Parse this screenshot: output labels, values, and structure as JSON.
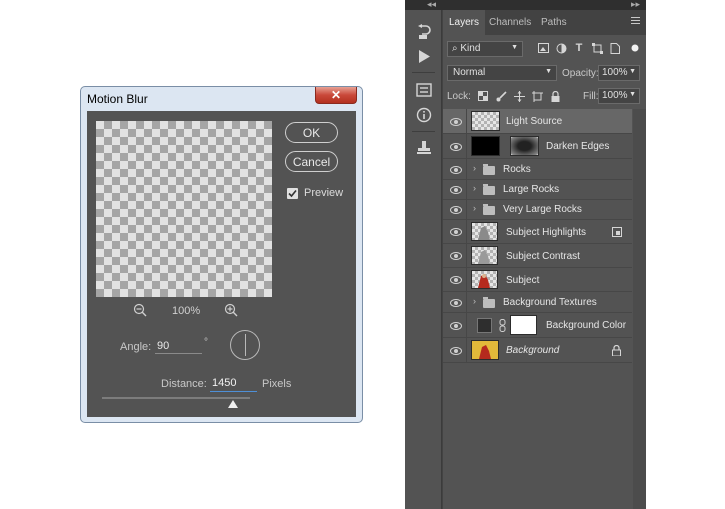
{
  "dialog": {
    "title": "Motion Blur",
    "close_glyph": "✕",
    "ok_label": "OK",
    "cancel_label": "Cancel",
    "preview_label": "Preview",
    "preview_checked": true,
    "zoom_percent": "100%",
    "angle_label": "Angle:",
    "angle_value": "90",
    "degree_symbol": "°",
    "distance_label": "Distance:",
    "distance_value": "1450",
    "distance_unit": "Pixels"
  },
  "tools": [
    {
      "name": "history-icon",
      "glyph": "↶"
    },
    {
      "name": "play-icon",
      "glyph": "▶"
    },
    {
      "name": "properties-icon",
      "glyph": "⚙"
    },
    {
      "name": "info-icon",
      "glyph": "ⓘ"
    },
    {
      "name": "clone-source-icon",
      "glyph": "⚲"
    }
  ],
  "layers_panel": {
    "tabs": [
      "Layers",
      "Channels",
      "Paths"
    ],
    "active_tab": "Layers",
    "filter_kind": "Kind",
    "blend_mode": "Normal",
    "opacity_label": "Opacity:",
    "opacity_value": "100%",
    "lock_label": "Lock:",
    "fill_label": "Fill:",
    "fill_value": "100%",
    "layers": [
      {
        "name": "Light Source",
        "type": "pixel",
        "thumb": "checker",
        "selected": true
      },
      {
        "name": "Darken Edges",
        "type": "adjustment",
        "thumb": "black",
        "mask": "dark-vignette"
      },
      {
        "name": "Rocks",
        "type": "group"
      },
      {
        "name": "Large Rocks",
        "type": "group"
      },
      {
        "name": "Very Large Rocks",
        "type": "group"
      },
      {
        "name": "Subject Highlights",
        "type": "pixel",
        "thumb": "subject",
        "badge": "clip-icon"
      },
      {
        "name": "Subject Contrast",
        "type": "pixel",
        "thumb": "subject"
      },
      {
        "name": "Subject",
        "type": "pixel",
        "thumb": "subject-red"
      },
      {
        "name": "Background Textures",
        "type": "group"
      },
      {
        "name": "Background Color",
        "type": "fill",
        "thumb": "dark",
        "mask": "white"
      },
      {
        "name": "Background",
        "type": "background",
        "thumb": "yellow",
        "italic": true,
        "badge": "lock-icon"
      }
    ]
  },
  "colors": {
    "panel_bg": "#535353",
    "selected_row": "#676767",
    "dialog_frame": "#dce6f2",
    "close_red": "#c9483a",
    "focus_blue": "#4e8fd6"
  }
}
